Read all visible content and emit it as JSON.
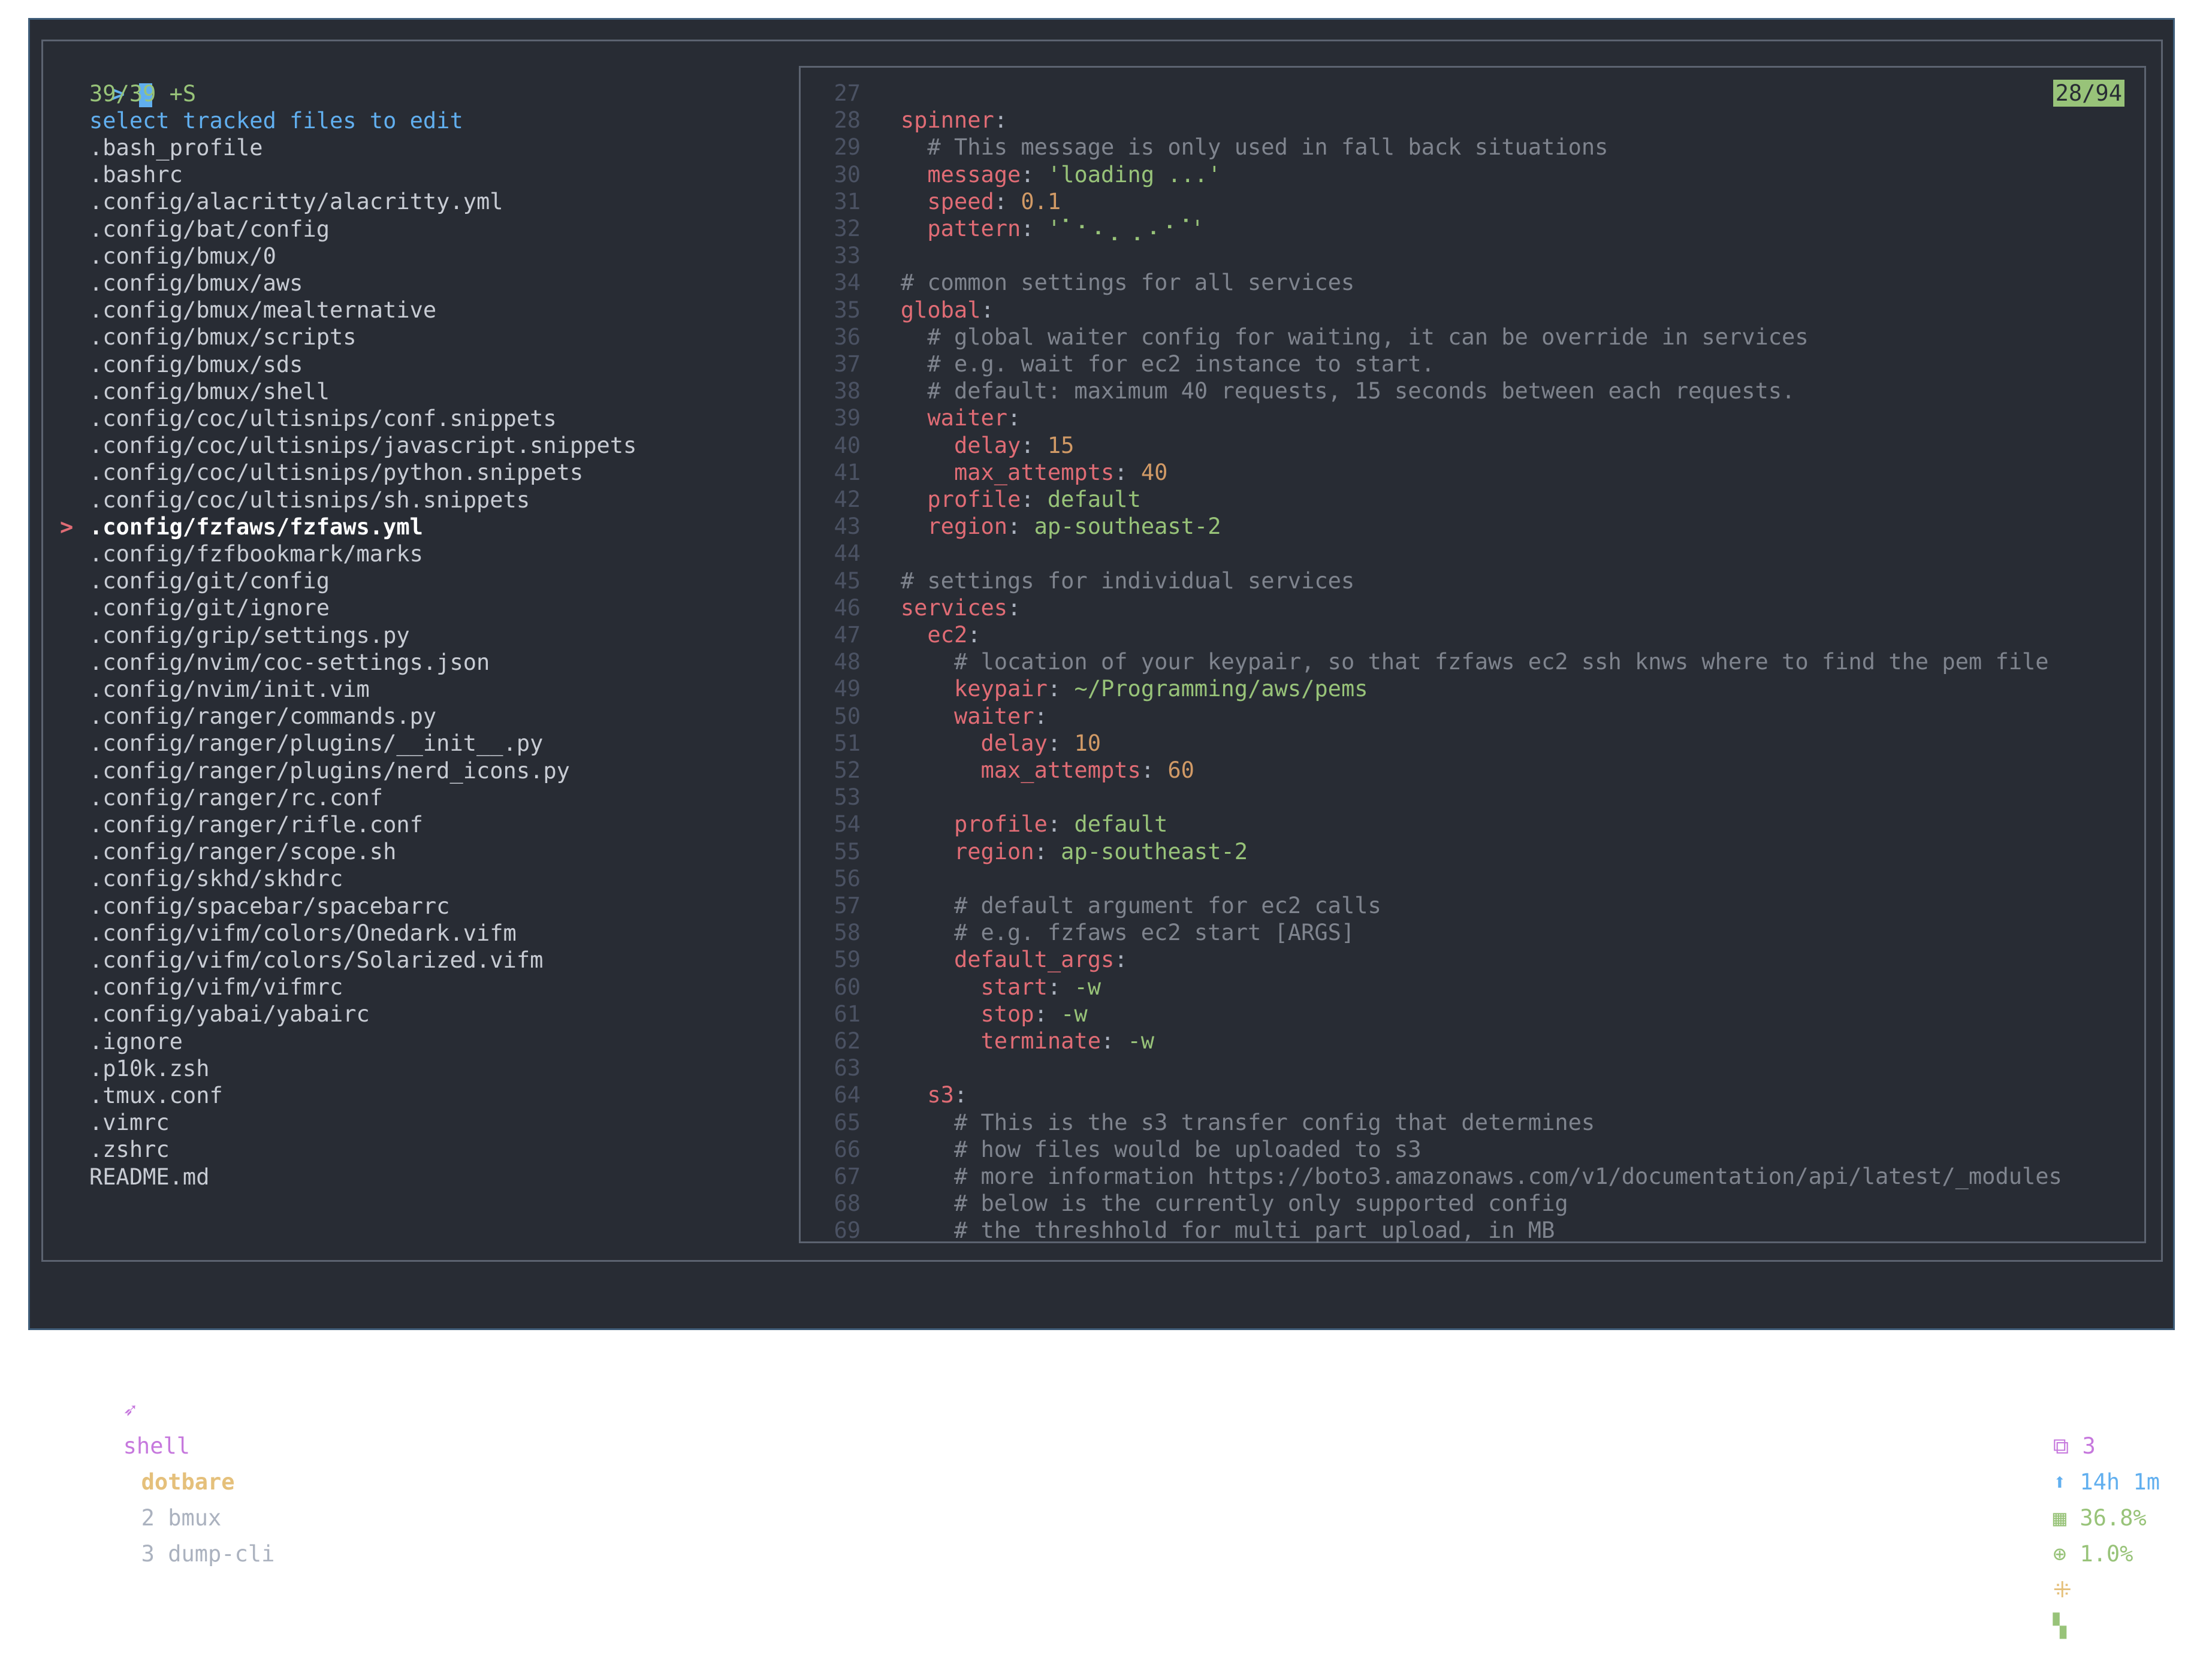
{
  "finder": {
    "prompt_symbol": ">",
    "count": "39/39 +S",
    "header": "select tracked files to edit",
    "selected_index": 14,
    "files": [
      ".bash_profile",
      ".bashrc",
      ".config/alacritty/alacritty.yml",
      ".config/bat/config",
      ".config/bmux/0",
      ".config/bmux/aws",
      ".config/bmux/mealternative",
      ".config/bmux/scripts",
      ".config/bmux/sds",
      ".config/bmux/shell",
      ".config/coc/ultisnips/conf.snippets",
      ".config/coc/ultisnips/javascript.snippets",
      ".config/coc/ultisnips/python.snippets",
      ".config/coc/ultisnips/sh.snippets",
      ".config/fzfaws/fzfaws.yml",
      ".config/fzfbookmark/marks",
      ".config/git/config",
      ".config/git/ignore",
      ".config/grip/settings.py",
      ".config/nvim/coc-settings.json",
      ".config/nvim/init.vim",
      ".config/ranger/commands.py",
      ".config/ranger/plugins/__init__.py",
      ".config/ranger/plugins/nerd_icons.py",
      ".config/ranger/rc.conf",
      ".config/ranger/rifle.conf",
      ".config/ranger/scope.sh",
      ".config/skhd/skhdrc",
      ".config/spacebar/spacebarrc",
      ".config/vifm/colors/Onedark.vifm",
      ".config/vifm/colors/Solarized.vifm",
      ".config/vifm/vifmrc",
      ".config/yabai/yabairc",
      ".ignore",
      ".p10k.zsh",
      ".tmux.conf",
      ".vimrc",
      ".zshrc",
      "README.md"
    ]
  },
  "preview": {
    "position": "28/94",
    "lines": [
      {
        "n": "27",
        "indent": 0,
        "segs": []
      },
      {
        "n": "28",
        "indent": 0,
        "segs": [
          {
            "t": "spinner",
            "c": "key"
          },
          {
            "t": ":",
            "c": "punct"
          }
        ]
      },
      {
        "n": "29",
        "indent": 1,
        "segs": [
          {
            "t": "# This message is only used in fall back situations",
            "c": "cmt"
          }
        ]
      },
      {
        "n": "30",
        "indent": 1,
        "segs": [
          {
            "t": "message",
            "c": "key"
          },
          {
            "t": ": ",
            "c": "punct"
          },
          {
            "t": "'loading ...'",
            "c": "str"
          }
        ]
      },
      {
        "n": "31",
        "indent": 1,
        "segs": [
          {
            "t": "speed",
            "c": "key"
          },
          {
            "t": ": ",
            "c": "punct"
          },
          {
            "t": "0.1",
            "c": "num"
          }
        ]
      },
      {
        "n": "32",
        "indent": 1,
        "segs": [
          {
            "t": "pattern",
            "c": "key"
          },
          {
            "t": ": ",
            "c": "punct"
          },
          {
            "t": "'⠁⠂⠄⡀⢀⠠⠐⠈'",
            "c": "str"
          }
        ]
      },
      {
        "n": "33",
        "indent": 0,
        "segs": []
      },
      {
        "n": "34",
        "indent": 0,
        "segs": [
          {
            "t": "# common settings for all services",
            "c": "cmt"
          }
        ]
      },
      {
        "n": "35",
        "indent": 0,
        "segs": [
          {
            "t": "global",
            "c": "key"
          },
          {
            "t": ":",
            "c": "punct"
          }
        ]
      },
      {
        "n": "36",
        "indent": 1,
        "segs": [
          {
            "t": "# global waiter config for waiting, it can be override in services",
            "c": "cmt"
          }
        ]
      },
      {
        "n": "37",
        "indent": 1,
        "segs": [
          {
            "t": "# e.g. wait for ec2 instance to start.",
            "c": "cmt"
          }
        ]
      },
      {
        "n": "38",
        "indent": 1,
        "segs": [
          {
            "t": "# default: maximum 40 requests, 15 seconds between each requests.",
            "c": "cmt"
          }
        ]
      },
      {
        "n": "39",
        "indent": 1,
        "segs": [
          {
            "t": "waiter",
            "c": "key"
          },
          {
            "t": ":",
            "c": "punct"
          }
        ]
      },
      {
        "n": "40",
        "indent": 2,
        "segs": [
          {
            "t": "delay",
            "c": "key"
          },
          {
            "t": ": ",
            "c": "punct"
          },
          {
            "t": "15",
            "c": "num"
          }
        ]
      },
      {
        "n": "41",
        "indent": 2,
        "segs": [
          {
            "t": "max_attempts",
            "c": "key"
          },
          {
            "t": ": ",
            "c": "punct"
          },
          {
            "t": "40",
            "c": "num"
          }
        ]
      },
      {
        "n": "42",
        "indent": 1,
        "segs": [
          {
            "t": "profile",
            "c": "key"
          },
          {
            "t": ": ",
            "c": "punct"
          },
          {
            "t": "default",
            "c": "str"
          }
        ]
      },
      {
        "n": "43",
        "indent": 1,
        "segs": [
          {
            "t": "region",
            "c": "key"
          },
          {
            "t": ": ",
            "c": "punct"
          },
          {
            "t": "ap-southeast-2",
            "c": "str"
          }
        ]
      },
      {
        "n": "44",
        "indent": 0,
        "segs": []
      },
      {
        "n": "45",
        "indent": 0,
        "segs": [
          {
            "t": "# settings for individual services",
            "c": "cmt"
          }
        ]
      },
      {
        "n": "46",
        "indent": 0,
        "segs": [
          {
            "t": "services",
            "c": "key"
          },
          {
            "t": ":",
            "c": "punct"
          }
        ]
      },
      {
        "n": "47",
        "indent": 1,
        "segs": [
          {
            "t": "ec2",
            "c": "key"
          },
          {
            "t": ":",
            "c": "punct"
          }
        ]
      },
      {
        "n": "48",
        "indent": 2,
        "segs": [
          {
            "t": "# location of your keypair, so that fzfaws ec2 ssh knws where to find the pem file",
            "c": "cmt"
          }
        ]
      },
      {
        "n": "49",
        "indent": 2,
        "segs": [
          {
            "t": "keypair",
            "c": "key"
          },
          {
            "t": ": ",
            "c": "punct"
          },
          {
            "t": "~/Programming/aws/pems",
            "c": "str"
          }
        ]
      },
      {
        "n": "50",
        "indent": 2,
        "segs": [
          {
            "t": "waiter",
            "c": "key"
          },
          {
            "t": ":",
            "c": "punct"
          }
        ]
      },
      {
        "n": "51",
        "indent": 3,
        "segs": [
          {
            "t": "delay",
            "c": "key"
          },
          {
            "t": ": ",
            "c": "punct"
          },
          {
            "t": "10",
            "c": "num"
          }
        ]
      },
      {
        "n": "52",
        "indent": 3,
        "segs": [
          {
            "t": "max_attempts",
            "c": "key"
          },
          {
            "t": ": ",
            "c": "punct"
          },
          {
            "t": "60",
            "c": "num"
          }
        ]
      },
      {
        "n": "53",
        "indent": 0,
        "segs": []
      },
      {
        "n": "54",
        "indent": 2,
        "segs": [
          {
            "t": "profile",
            "c": "key"
          },
          {
            "t": ": ",
            "c": "punct"
          },
          {
            "t": "default",
            "c": "str"
          }
        ]
      },
      {
        "n": "55",
        "indent": 2,
        "segs": [
          {
            "t": "region",
            "c": "key"
          },
          {
            "t": ": ",
            "c": "punct"
          },
          {
            "t": "ap-southeast-2",
            "c": "str"
          }
        ]
      },
      {
        "n": "56",
        "indent": 0,
        "segs": []
      },
      {
        "n": "57",
        "indent": 2,
        "segs": [
          {
            "t": "# default argument for ec2 calls",
            "c": "cmt"
          }
        ]
      },
      {
        "n": "58",
        "indent": 2,
        "segs": [
          {
            "t": "# e.g. fzfaws ec2 start [ARGS]",
            "c": "cmt"
          }
        ]
      },
      {
        "n": "59",
        "indent": 2,
        "segs": [
          {
            "t": "default_args",
            "c": "key"
          },
          {
            "t": ":",
            "c": "punct"
          }
        ]
      },
      {
        "n": "60",
        "indent": 3,
        "segs": [
          {
            "t": "start",
            "c": "key"
          },
          {
            "t": ": ",
            "c": "punct"
          },
          {
            "t": "-w",
            "c": "str"
          }
        ]
      },
      {
        "n": "61",
        "indent": 3,
        "segs": [
          {
            "t": "stop",
            "c": "key"
          },
          {
            "t": ": ",
            "c": "punct"
          },
          {
            "t": "-w",
            "c": "str"
          }
        ]
      },
      {
        "n": "62",
        "indent": 3,
        "segs": [
          {
            "t": "terminate",
            "c": "key"
          },
          {
            "t": ": ",
            "c": "punct"
          },
          {
            "t": "-w",
            "c": "str"
          }
        ]
      },
      {
        "n": "63",
        "indent": 0,
        "segs": []
      },
      {
        "n": "64",
        "indent": 1,
        "segs": [
          {
            "t": "s3",
            "c": "key"
          },
          {
            "t": ":",
            "c": "punct"
          }
        ]
      },
      {
        "n": "65",
        "indent": 2,
        "segs": [
          {
            "t": "# This is the s3 transfer config that determines",
            "c": "cmt"
          }
        ]
      },
      {
        "n": "66",
        "indent": 2,
        "segs": [
          {
            "t": "# how files would be uploaded to s3",
            "c": "cmt"
          }
        ]
      },
      {
        "n": "67",
        "indent": 2,
        "segs": [
          {
            "t": "# more information https://boto3.amazonaws.com/v1/documentation/api/latest/_modules",
            "c": "cmt"
          }
        ]
      },
      {
        "n": "68",
        "indent": 2,
        "segs": [
          {
            "t": "# below is the currently only supported config",
            "c": "cmt"
          }
        ]
      },
      {
        "n": "69",
        "indent": 2,
        "segs": [
          {
            "t": "# the threshhold for multi part upload, in MB",
            "c": "cmt"
          }
        ]
      }
    ]
  },
  "statusbar": {
    "session_icon": "➶",
    "session": "shell",
    "active_window": "dotbare",
    "windows": [
      "2 bmux",
      "3 dump-cli"
    ],
    "panes": "⧉ 3",
    "uptime": "⬆ 14h 1m",
    "memory": "▦ 36.8%",
    "cpu": "⊕ 1.0%",
    "extra1": "⁜",
    "extra2": "▚"
  },
  "colors": {
    "background": "#282c34",
    "accent_blue": "#61afef",
    "key_red": "#e06c75",
    "string_green": "#98c379",
    "number_orange": "#d19a66",
    "comment_gray": "#7f848e",
    "purple": "#c678dd",
    "yellow": "#e5c07b"
  }
}
